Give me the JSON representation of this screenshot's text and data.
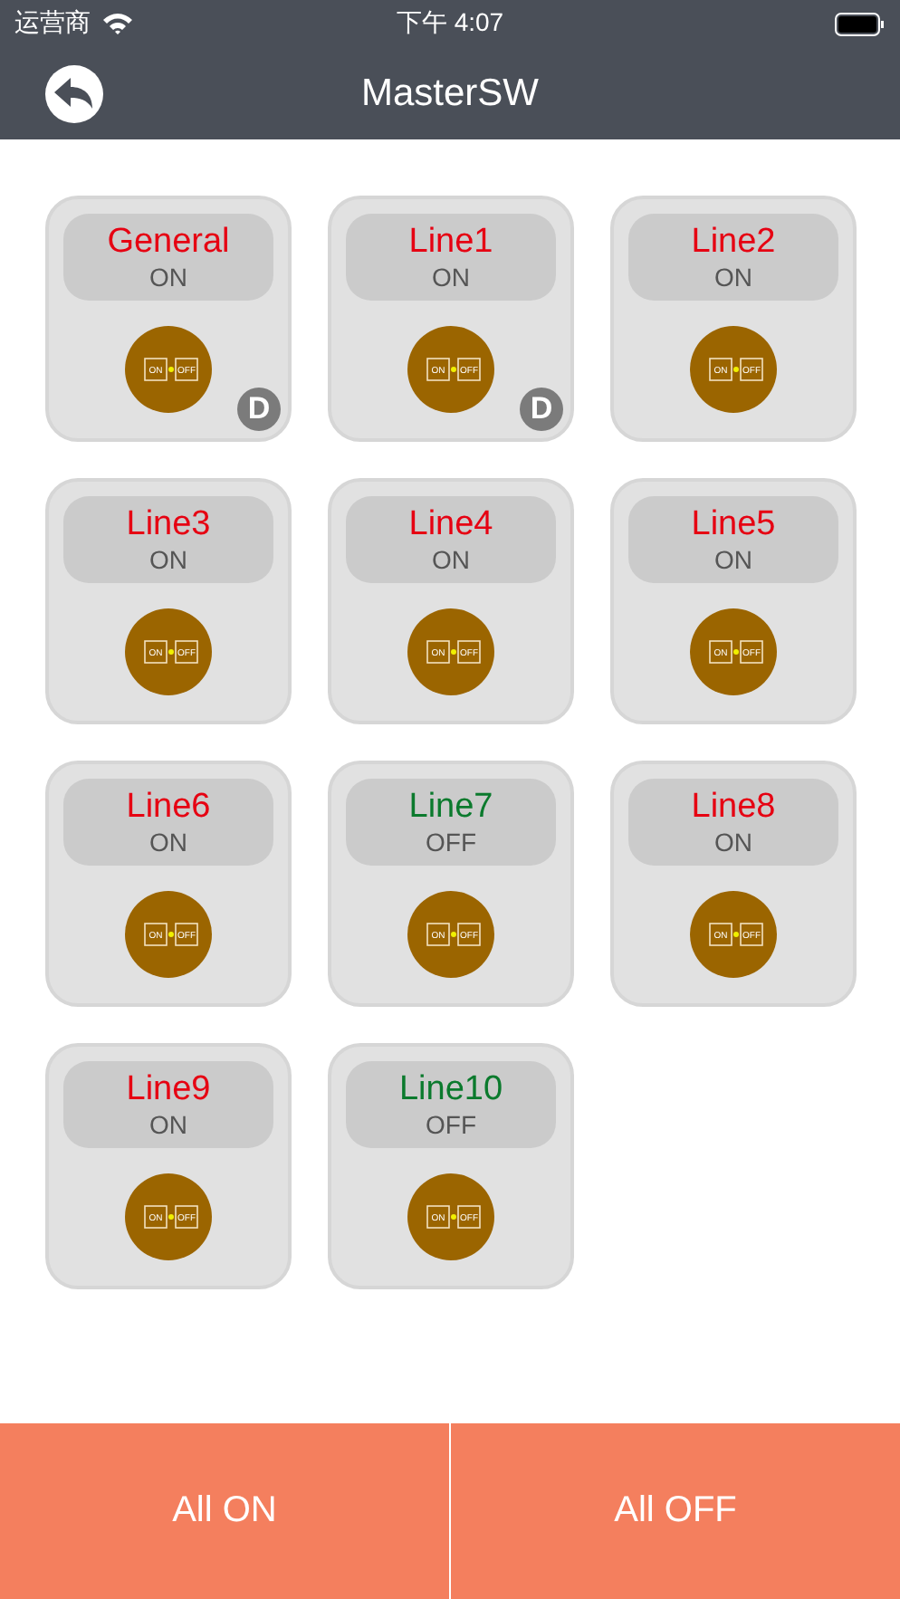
{
  "status_bar": {
    "carrier": "运营商",
    "time": "下午 4:07"
  },
  "nav": {
    "title": "MasterSW"
  },
  "switches": [
    {
      "name": "General",
      "on": true,
      "status": "ON",
      "switch_on_label": "ON",
      "switch_off_label": "OFF",
      "badge": "D"
    },
    {
      "name": "Line1",
      "on": true,
      "status": "ON",
      "switch_on_label": "ON",
      "switch_off_label": "OFF",
      "badge": "D"
    },
    {
      "name": "Line2",
      "on": true,
      "status": "ON",
      "switch_on_label": "ON",
      "switch_off_label": "OFF"
    },
    {
      "name": "Line3",
      "on": true,
      "status": "ON",
      "switch_on_label": "ON",
      "switch_off_label": "OFF"
    },
    {
      "name": "Line4",
      "on": true,
      "status": "ON",
      "switch_on_label": "ON",
      "switch_off_label": "OFF"
    },
    {
      "name": "Line5",
      "on": true,
      "status": "ON",
      "switch_on_label": "ON",
      "switch_off_label": "OFF"
    },
    {
      "name": "Line6",
      "on": true,
      "status": "ON",
      "switch_on_label": "ON",
      "switch_off_label": "OFF"
    },
    {
      "name": "Line7",
      "on": false,
      "status": "OFF",
      "switch_on_label": "ON",
      "switch_off_label": "OFF"
    },
    {
      "name": "Line8",
      "on": true,
      "status": "ON",
      "switch_on_label": "ON",
      "switch_off_label": "OFF"
    },
    {
      "name": "Line9",
      "on": true,
      "status": "ON",
      "switch_on_label": "ON",
      "switch_off_label": "OFF"
    },
    {
      "name": "Line10",
      "on": false,
      "status": "OFF",
      "switch_on_label": "ON",
      "switch_off_label": "OFF"
    }
  ],
  "buttons": [
    "All ON",
    "All OFF"
  ]
}
